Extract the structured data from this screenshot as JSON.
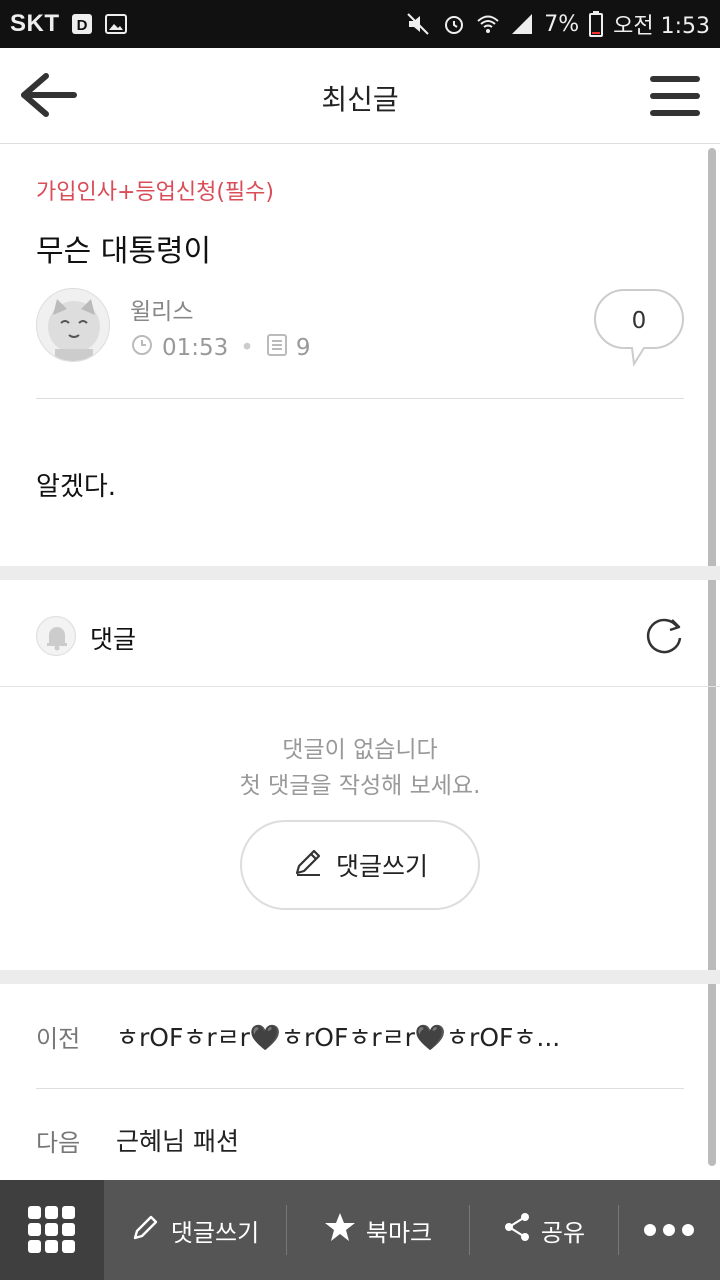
{
  "status_bar": {
    "carrier": "SKT",
    "battery": "7%",
    "time": "오전 1:53"
  },
  "app_bar": {
    "title": "최신글",
    "back_icon": "back-arrow-icon",
    "menu_icon": "hamburger-menu-icon"
  },
  "post": {
    "board": "가입인사+등업신청(필수)",
    "title": "무슨 대통령이",
    "author": "윌리스",
    "time": "01:53",
    "views": "9",
    "comment_count": "0",
    "body": "알겠다."
  },
  "comments": {
    "header": "댓글",
    "empty_line1": "댓글이 없습니다",
    "empty_line2": "첫 댓글을 작성해 보세요.",
    "write_button": "댓글쓰기"
  },
  "navigation": {
    "prev_label": "이전",
    "prev_title": "ㅎrOFㅎrㄹr🖤ㅎrOFㅎrㄹr🖤ㅎrOFㅎ...",
    "next_label": "다음",
    "next_title": "근혜님 패션"
  },
  "bottom_bar": {
    "write": "댓글쓰기",
    "bookmark": "북마크",
    "share": "공유"
  },
  "colors": {
    "board_accent": "#d94d58",
    "bottom_bar": "#555555",
    "status_bar": "#111111"
  }
}
